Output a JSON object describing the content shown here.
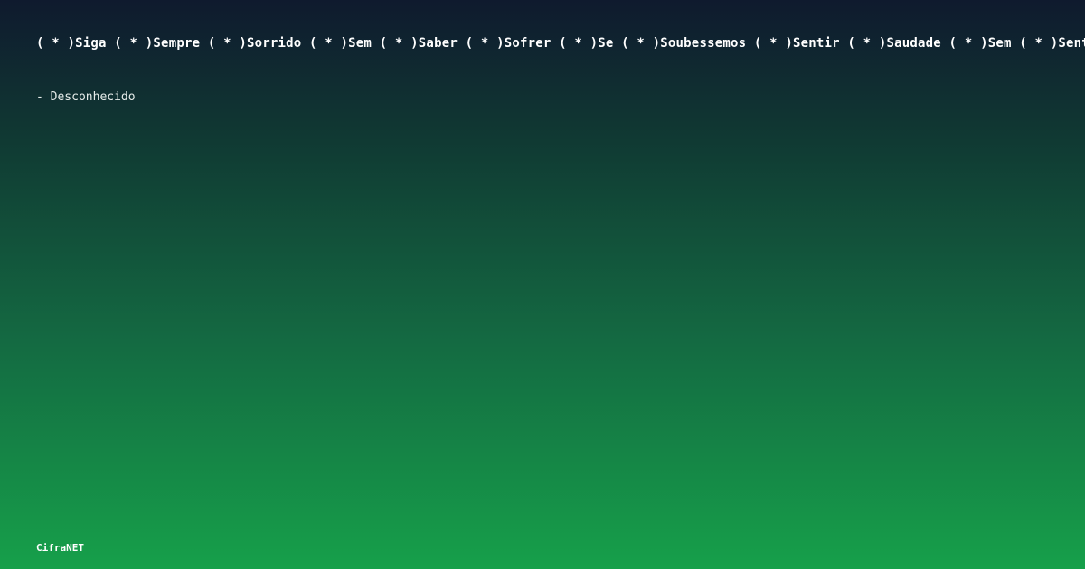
{
  "quote": {
    "text": "( * )Siga ( * )Sempre ( * )Sorrido ( * )Sem ( * )Saber ( * )Sofrer ( * )Se ( * )Soubessemos ( * )Sentir ( * )Saudade ( * )Sem ( * )Sentido ( * )"
  },
  "author": {
    "text": "- Desconhecido"
  },
  "brand": {
    "name": "CifraNET"
  },
  "colors": {
    "background_top": "#0f1a2e",
    "background_bottom": "#16a04a",
    "text": "#ffffff"
  }
}
